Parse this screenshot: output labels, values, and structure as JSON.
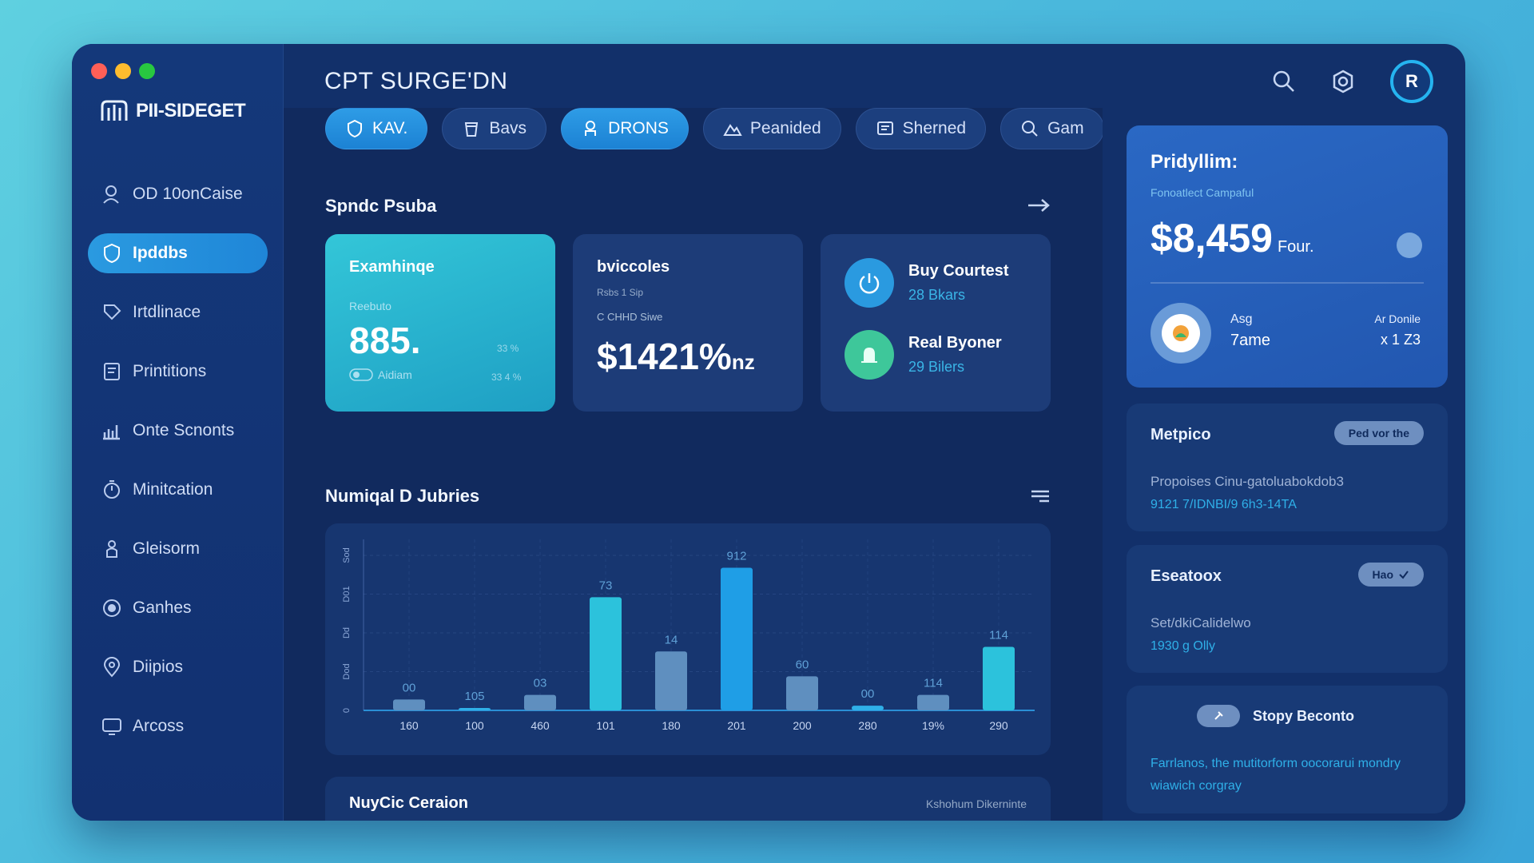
{
  "app": {
    "logo_text": "PII-SIDEGET",
    "title": "CPT SURGE'DN"
  },
  "sidebar": {
    "items": [
      {
        "label": "OD 10onCaise",
        "icon": "user-search-icon"
      },
      {
        "label": "Ipddbs",
        "icon": "shield-icon",
        "active": true
      },
      {
        "label": "Irtdlinace",
        "icon": "tag-icon"
      },
      {
        "label": "Printitions",
        "icon": "document-icon"
      },
      {
        "label": "Onte Scnonts",
        "icon": "bar-chart-icon"
      },
      {
        "label": "Minitcation",
        "icon": "timer-icon"
      },
      {
        "label": "Gleisorm",
        "icon": "person-icon"
      },
      {
        "label": "Ganhes",
        "icon": "circle-icon"
      },
      {
        "label": "Diipios",
        "icon": "location-icon"
      },
      {
        "label": "Arcoss",
        "icon": "monitor-icon"
      }
    ]
  },
  "header": {
    "avatar_initial": "R"
  },
  "tabs": [
    {
      "label": "KAV.",
      "active": true
    },
    {
      "label": "Bavs"
    },
    {
      "label": "DRONS",
      "active": true
    },
    {
      "label": "Peanided"
    },
    {
      "label": "Sherned"
    },
    {
      "label": "Gam"
    }
  ],
  "summary": {
    "title": "Spndc Psuba",
    "card1": {
      "label": "Examhinqe",
      "sub": "Reebuto",
      "value": "885.",
      "footer": "Aidiam",
      "mini1": "33 %",
      "mini2": "33 4 %"
    },
    "card2": {
      "label": "bviccoles",
      "sub1": "Rsbs 1 Sip",
      "sub2": "C CHHD Siwe",
      "value": "$1421%",
      "suffix": "nz"
    },
    "card3": {
      "rows": [
        {
          "name": "Buy Courtest",
          "sub": "28 Bkars"
        },
        {
          "name": "Real Byoner",
          "sub": "29 Bilers"
        }
      ]
    }
  },
  "chart_section": {
    "title": "Numiqal D Jubries"
  },
  "chart_data": {
    "type": "bar",
    "categories": [
      "160",
      "100",
      "460",
      "101",
      "180",
      "201",
      "200",
      "280",
      "19%",
      "290"
    ],
    "values": [
      7,
      1,
      10,
      73,
      38,
      92,
      22,
      3,
      10,
      41
    ],
    "labels": [
      "00",
      "105",
      "03",
      "73",
      "14",
      "912",
      "60",
      "00",
      "114",
      "114"
    ],
    "y_ticks": [
      "0",
      "Dod",
      "Dd",
      "D01",
      "Sod"
    ],
    "ylim": [
      0,
      100
    ],
    "grid": true
  },
  "bottom_card": {
    "title": "NuyCic Ceraion",
    "right_text": "Kshohum Dikerninte"
  },
  "promo": {
    "title": "Pridyllim:",
    "subtitle": "Fonoatlect Campaful",
    "value": "$8,459",
    "value_suffix": "Four.",
    "label_left": "Asg",
    "value_left": "7ame",
    "label_right": "Ar Donile",
    "value_right": "x 1 Z3"
  },
  "side_cards": [
    {
      "title": "Metpico",
      "pill": "Ped vor the",
      "text": "Propoises Cinu-gatoluabokdob3",
      "link": "9121 7/IDNBI/9 6h3-14TA"
    },
    {
      "title": "Eseatoox",
      "pill": "Hao",
      "text": "Set/dkiCalidelwo",
      "link": "1930 g Olly"
    },
    {
      "title": "Stopy Beconto",
      "text": "Farrlanos, the mutitorform oocorarui mondry wiawich corgray"
    }
  ],
  "colors": {
    "accent": "#2a9ae0",
    "teal": "#33c6d8",
    "window_bg": "#12306a",
    "link": "#2fb0e8"
  }
}
